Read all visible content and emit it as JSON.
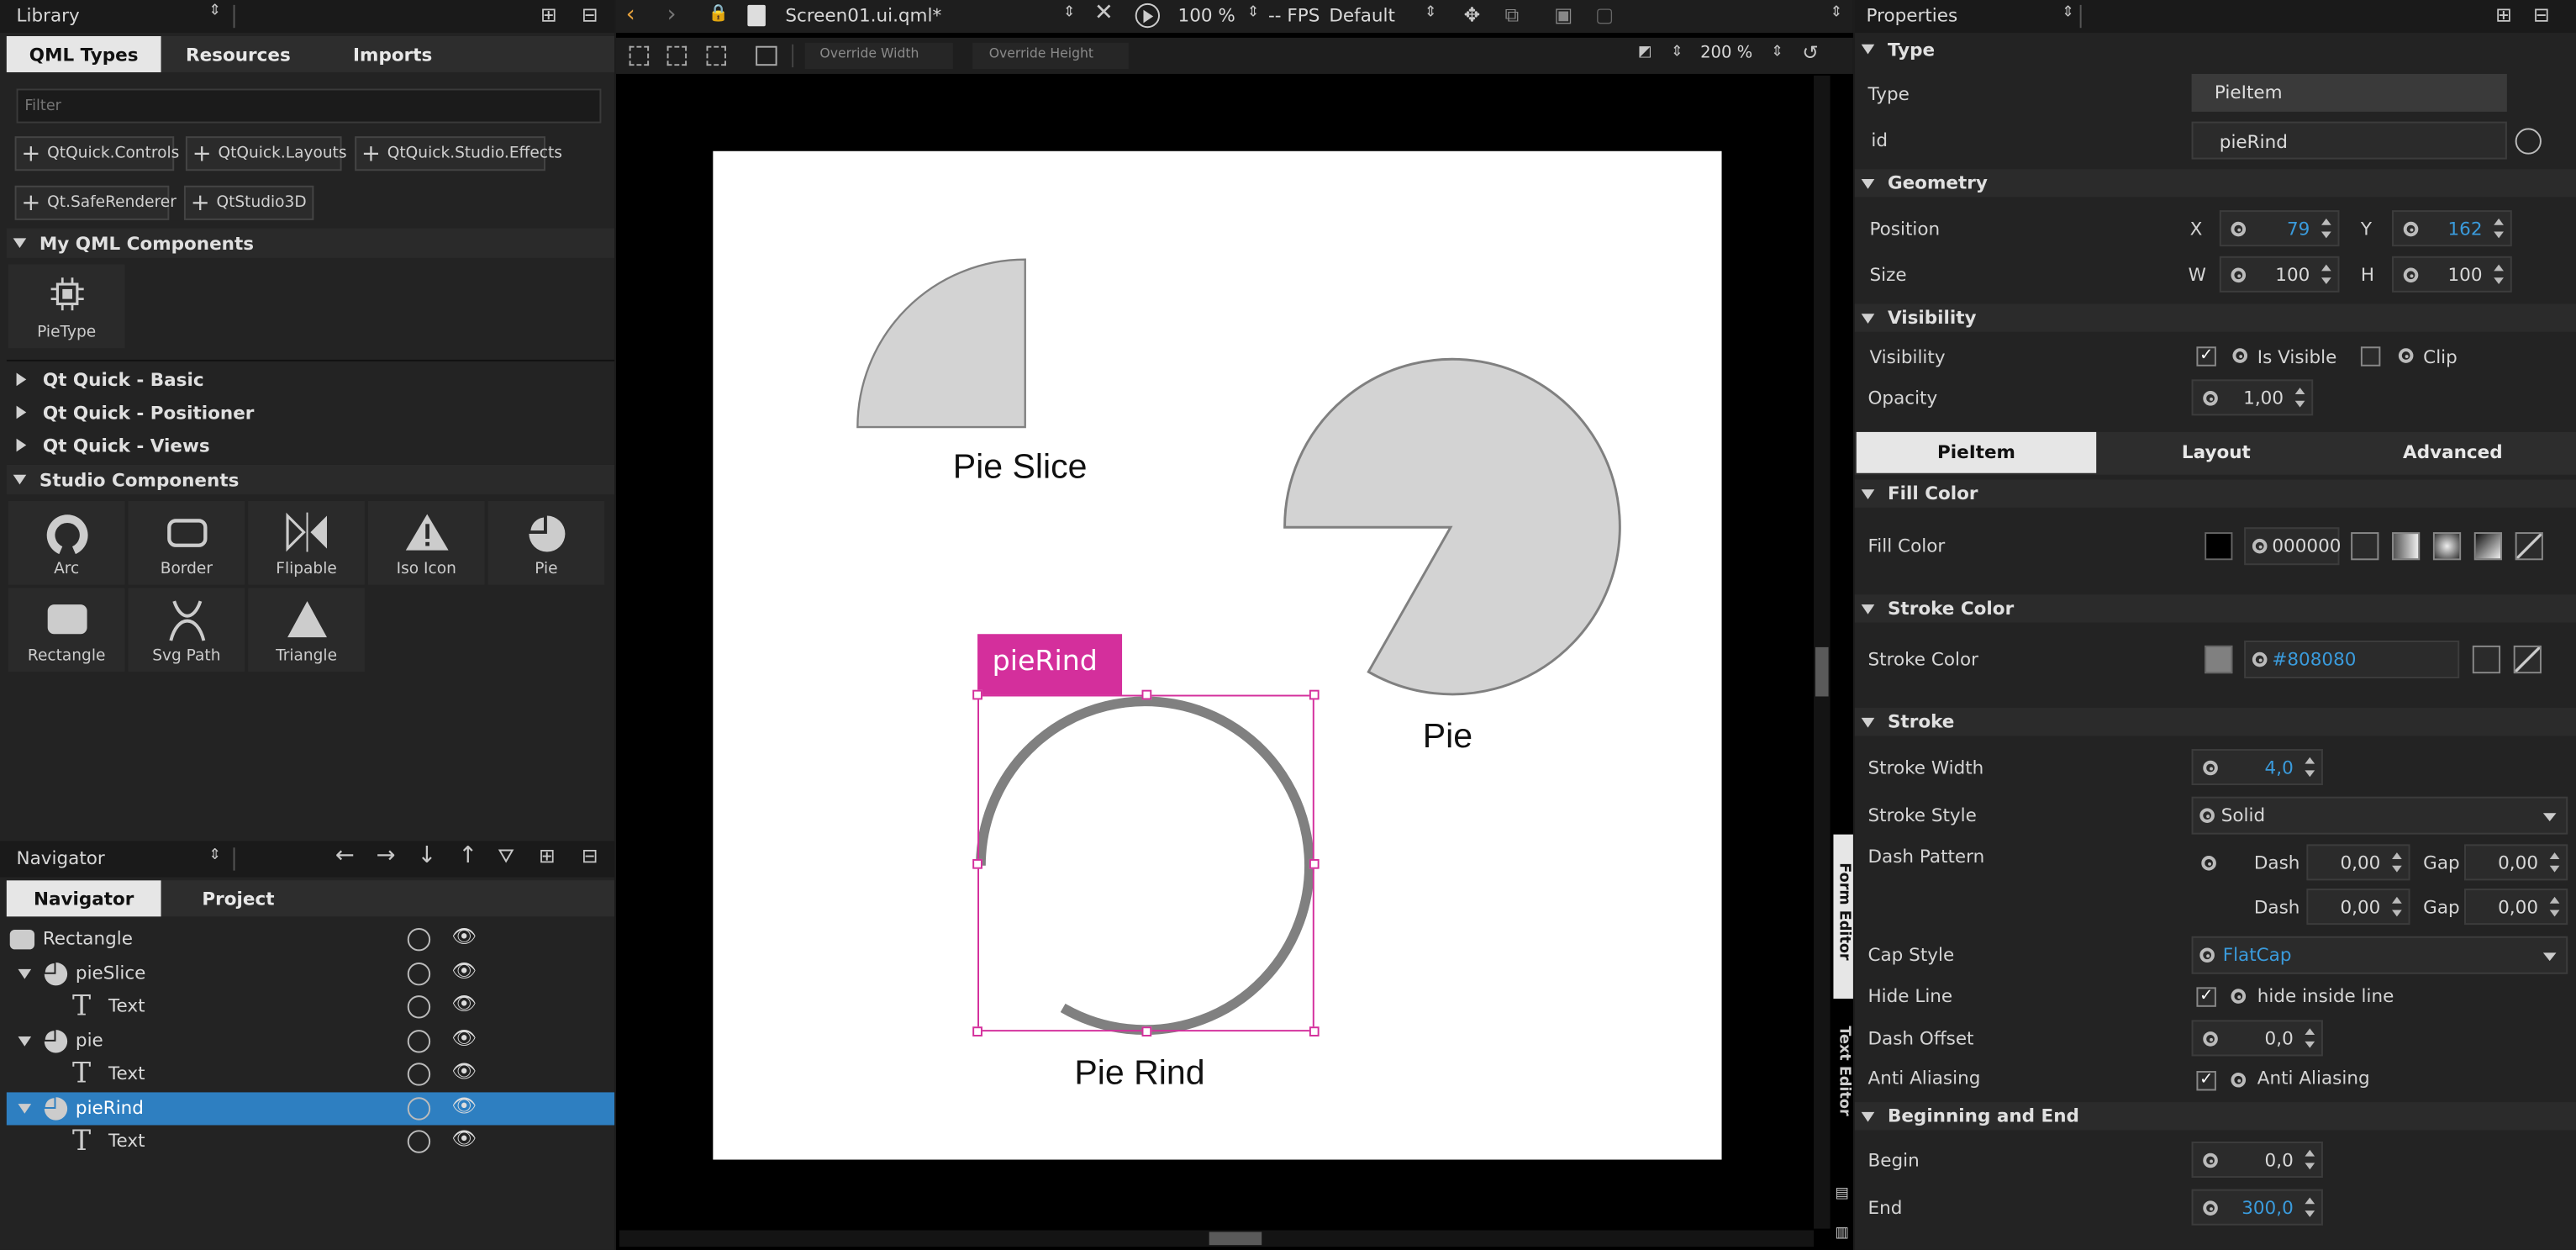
{
  "library": {
    "dropdown": "Library",
    "tabs": [
      "QML Types",
      "Resources",
      "Imports"
    ],
    "filter_placeholder": "Filter",
    "imports": [
      "QtQuick.Controls",
      "QtQuick.Layouts",
      "QtQuick.Studio.Effects",
      "Qt.SafeRenderer",
      "QtStudio3D"
    ],
    "my_components_header": "My QML Components",
    "my_components": [
      {
        "label": "PieType",
        "icon": "cpu-chip-icon"
      }
    ],
    "collapsed_sections": [
      "Qt Quick - Basic",
      "Qt Quick - Positioner",
      "Qt Quick - Views"
    ],
    "studio_header": "Studio Components",
    "studio_components": [
      {
        "label": "Arc",
        "icon": "arc-icon"
      },
      {
        "label": "Border",
        "icon": "border-icon"
      },
      {
        "label": "Flipable",
        "icon": "flipable-icon"
      },
      {
        "label": "Iso Icon",
        "icon": "iso-icon"
      },
      {
        "label": "Pie",
        "icon": "pie-icon"
      },
      {
        "label": "Rectangle",
        "icon": "rectangle-icon"
      },
      {
        "label": "Svg Path",
        "icon": "svg-path-icon"
      },
      {
        "label": "Triangle",
        "icon": "triangle-icon"
      }
    ]
  },
  "navigator": {
    "dropdown": "Navigator",
    "tabs": [
      "Navigator",
      "Project"
    ],
    "items": [
      {
        "label": "Rectangle",
        "icon": "rectangle-icon",
        "expanded": null,
        "selected": false
      },
      {
        "label": "pieSlice",
        "icon": "pie-icon",
        "expanded": true,
        "selected": false
      },
      {
        "label": "Text",
        "icon": "text-icon",
        "expanded": null,
        "selected": false
      },
      {
        "label": "pie",
        "icon": "pie-icon",
        "expanded": true,
        "selected": false
      },
      {
        "label": "Text",
        "icon": "text-icon",
        "expanded": null,
        "selected": false
      },
      {
        "label": "pieRind",
        "icon": "pie-icon",
        "expanded": true,
        "selected": true
      },
      {
        "label": "Text",
        "icon": "text-icon",
        "expanded": null,
        "selected": false
      }
    ]
  },
  "editor": {
    "file": "Screen01.ui.qml*",
    "zoom": "100 %",
    "fps": "-- FPS",
    "style": "Default",
    "override_width": "Override Width",
    "override_height": "Override Height",
    "canvas_zoom": "200 %",
    "side_tabs": [
      "Form Editor",
      "Text Editor"
    ],
    "canvas": {
      "labels": {
        "pie_slice": "Pie Slice",
        "pie": "Pie",
        "pie_rind": "Pie Rind"
      },
      "selection_tag": "pieRind",
      "selection_color": "#d42f9c",
      "shape_fill": "#d3d3d3",
      "stroke_color": "#808080"
    }
  },
  "properties": {
    "dropdown": "Properties",
    "type_section": "Type",
    "type_label": "Type",
    "type_value": "PieItem",
    "id_label": "id",
    "id_value": "pieRind",
    "geometry_section": "Geometry",
    "position_label": "Position",
    "x_label": "X",
    "x_value": "79",
    "y_label": "Y",
    "y_value": "162",
    "size_label": "Size",
    "w_label": "W",
    "w_value": "100",
    "h_label": "H",
    "h_value": "100",
    "visibility_section": "Visibility",
    "visibility_label": "Visibility",
    "is_visible": "Is Visible",
    "clip": "Clip",
    "opacity_label": "Opacity",
    "opacity_value": "1,00",
    "tabs": [
      "PieItem",
      "Layout",
      "Advanced"
    ],
    "fill_section": "Fill Color",
    "fill_label": "Fill Color",
    "fill_value": "000000",
    "stroke_color_section": "Stroke Color",
    "stroke_color_label": "Stroke Color",
    "stroke_color_value": "#808080",
    "stroke_section": "Stroke",
    "stroke_width_label": "Stroke Width",
    "stroke_width_value": "4,0",
    "stroke_style_label": "Stroke Style",
    "stroke_style_value": "Solid",
    "dash_pattern_label": "Dash Pattern",
    "dash_label": "Dash",
    "gap_label": "Gap",
    "dash1": "0,00",
    "gap1": "0,00",
    "dash2": "0,00",
    "gap2": "0,00",
    "cap_style_label": "Cap Style",
    "cap_style_value": "FlatCap",
    "hide_line_label": "Hide Line",
    "hide_line_value": "hide inside line",
    "dash_offset_label": "Dash Offset",
    "dash_offset_value": "0,0",
    "anti_aliasing_label": "Anti Aliasing",
    "anti_aliasing_value": "Anti Aliasing",
    "begin_end_section": "Beginning and End",
    "begin_label": "Begin",
    "begin_value": "0,0",
    "end_label": "End",
    "end_value": "300,0"
  }
}
